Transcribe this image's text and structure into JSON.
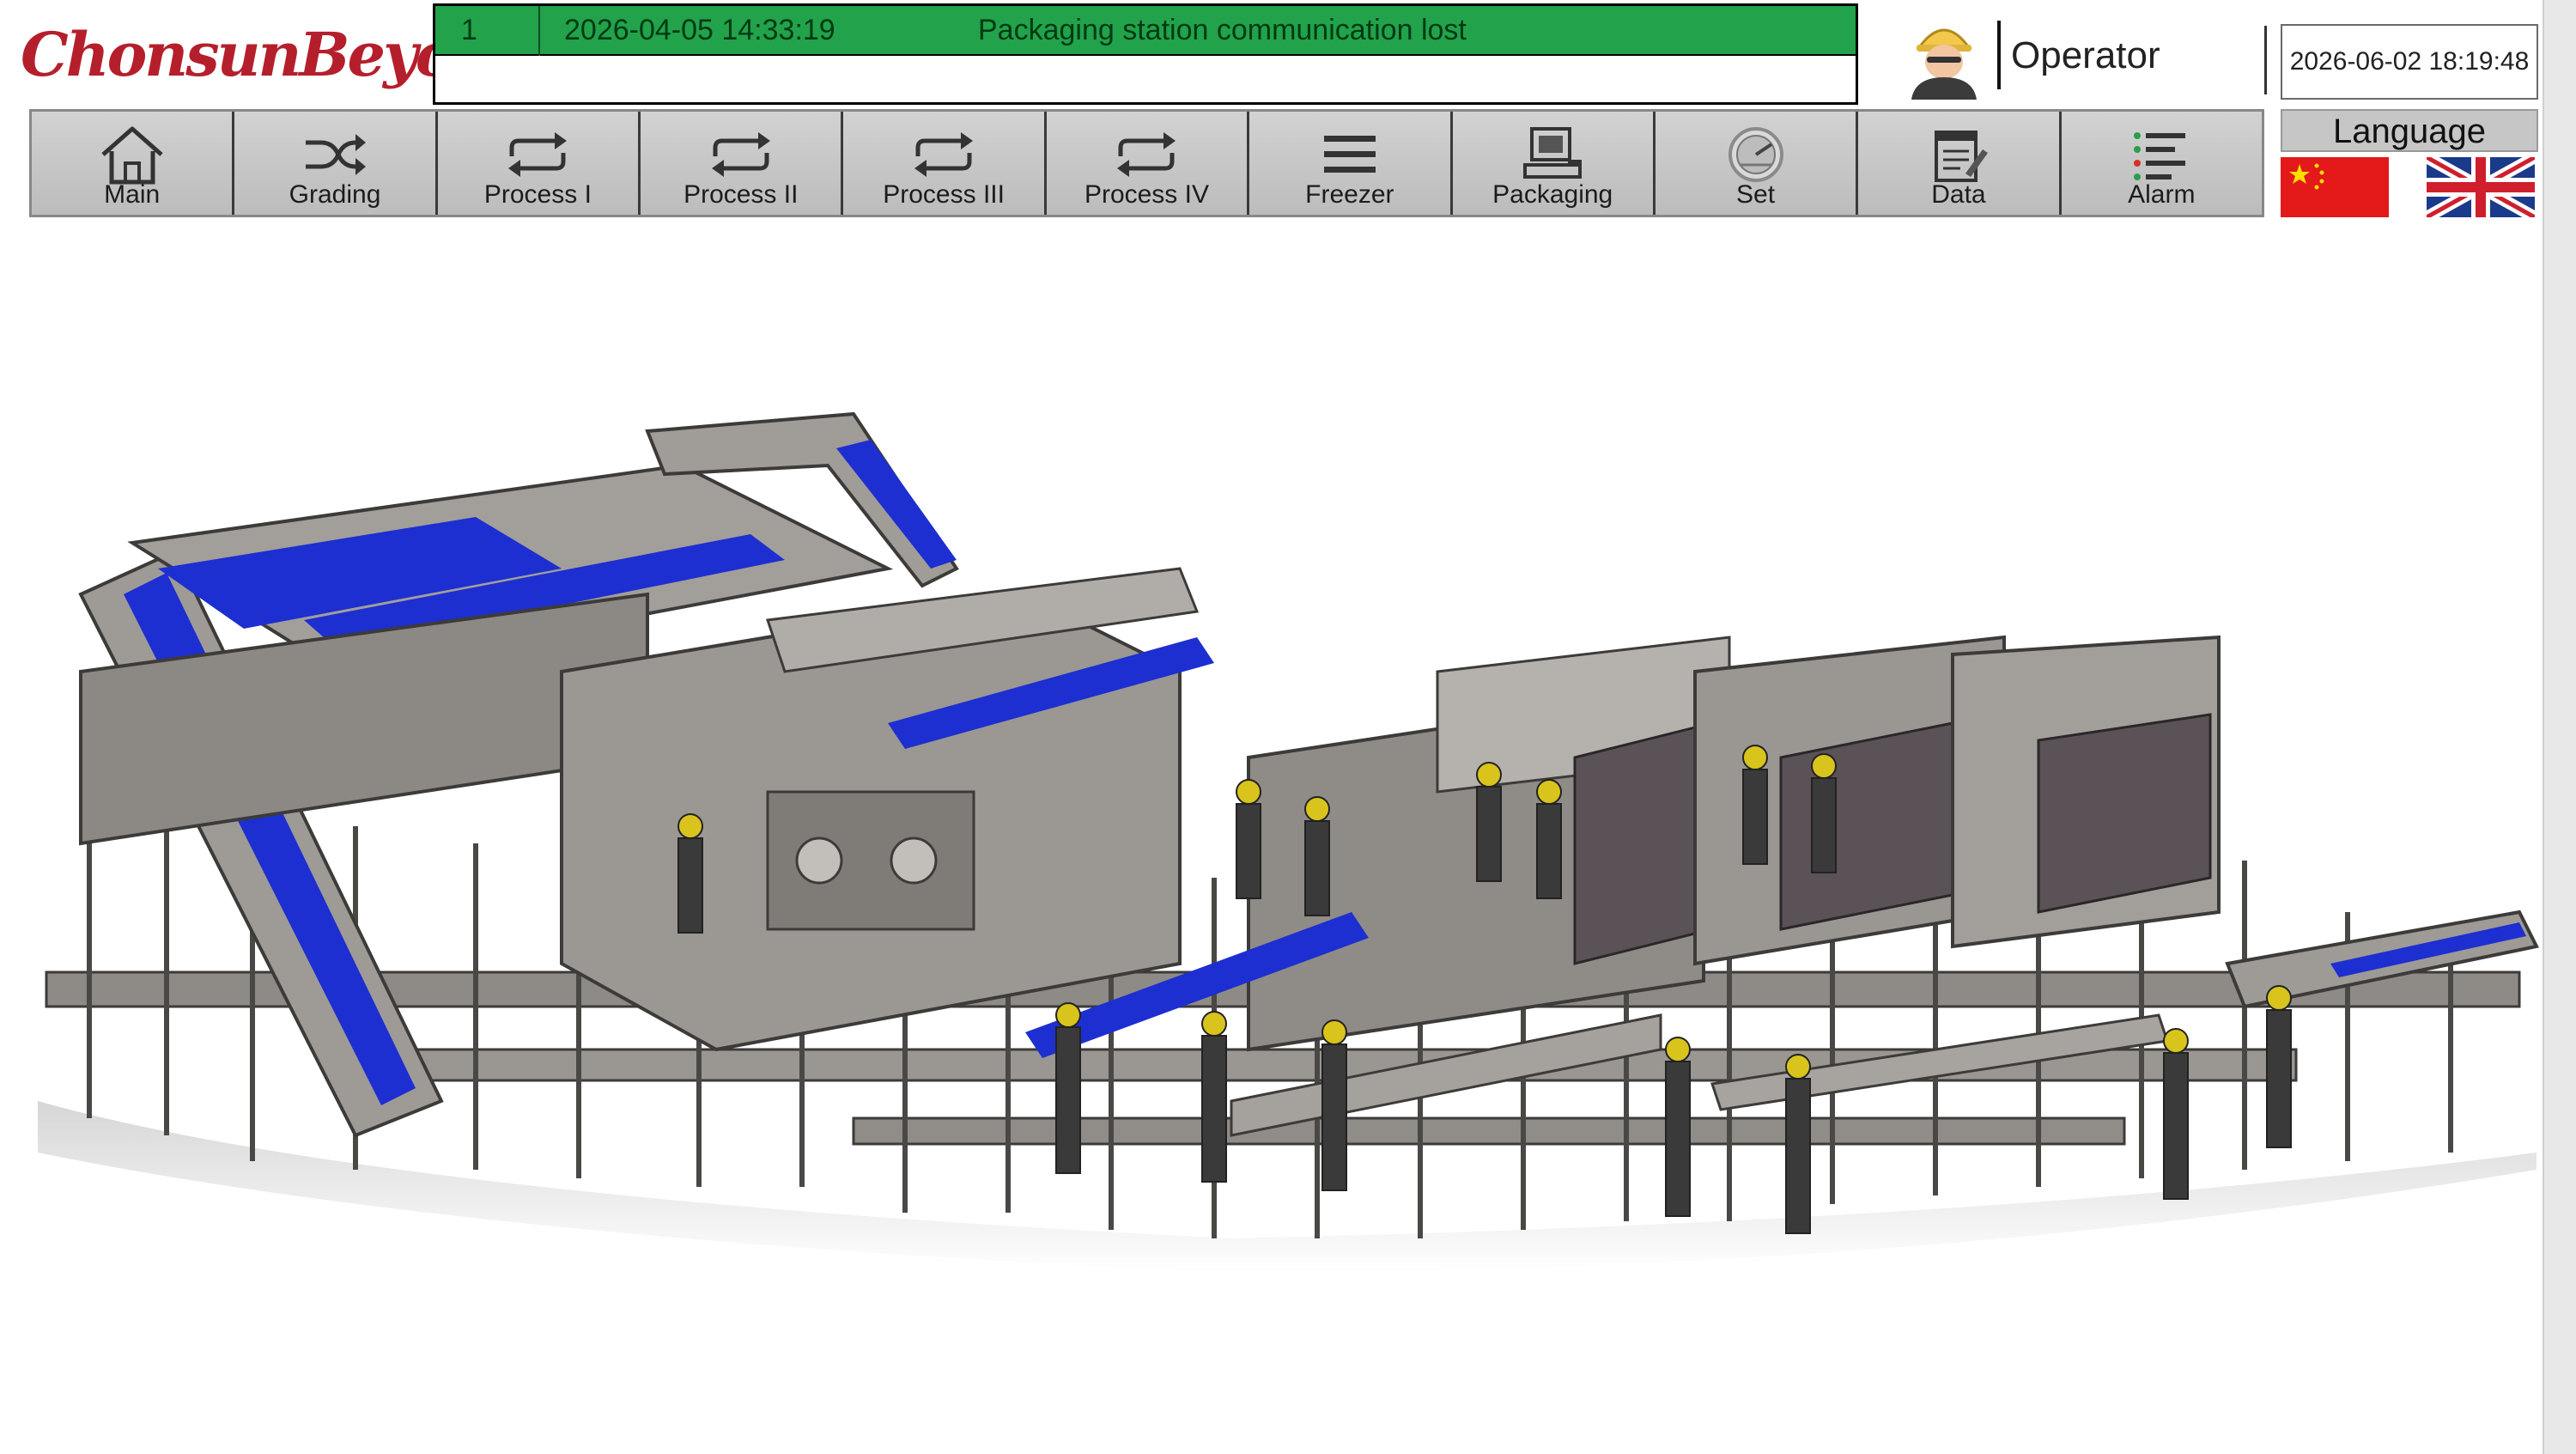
{
  "header": {
    "logo_text": "ChonsunBeyond",
    "alarm": {
      "id": "1",
      "timestamp": "2026-04-05  14:33:19",
      "message": "Packaging station communication lost",
      "color": "#22a24a"
    },
    "user": {
      "role": "Operator",
      "avatar_icon": "worker-avatar-icon"
    },
    "datetime": "2026-06-02 18:19:48"
  },
  "nav": {
    "items": [
      {
        "label": "Main",
        "icon": "home-icon"
      },
      {
        "label": "Grading",
        "icon": "shuffle-icon"
      },
      {
        "label": "Process I",
        "icon": "repeat-icon"
      },
      {
        "label": "Process II",
        "icon": "repeat-icon"
      },
      {
        "label": "Process III",
        "icon": "repeat-icon"
      },
      {
        "label": "Process IV",
        "icon": "repeat-icon"
      },
      {
        "label": "Freezer",
        "icon": "menu-lines-icon"
      },
      {
        "label": "Packaging",
        "icon": "scale-icon"
      },
      {
        "label": "Set",
        "icon": "dial-icon"
      },
      {
        "label": "Data",
        "icon": "notepad-icon"
      },
      {
        "label": "Alarm",
        "icon": "alarm-list-icon"
      }
    ]
  },
  "language": {
    "title": "Language",
    "options": [
      {
        "name": "Chinese",
        "icon": "china-flag-icon"
      },
      {
        "name": "English",
        "icon": "uk-flag-icon"
      }
    ]
  },
  "main": {
    "image_icon": "processing-line-3d-model",
    "conveyor_color": "#1d2fd0",
    "frame_color": "#8e8a86"
  }
}
